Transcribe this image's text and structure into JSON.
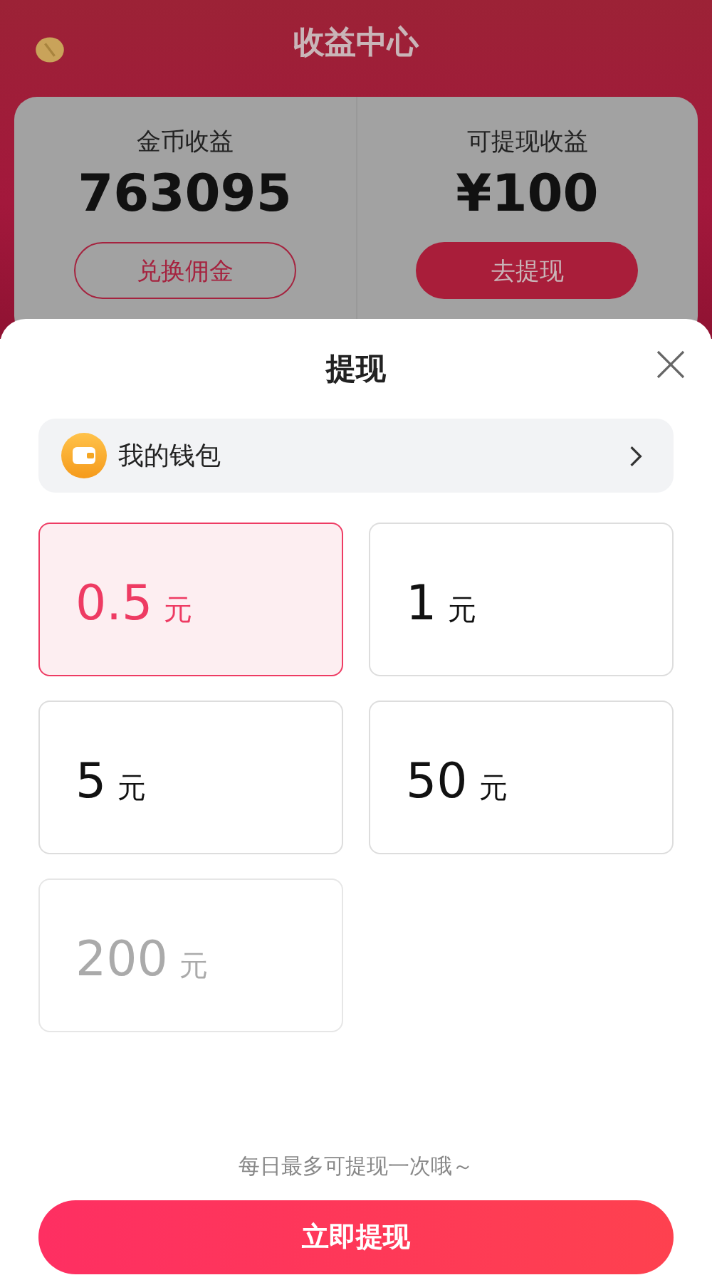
{
  "page_title": "收益中心",
  "stats": [
    {
      "label": "金币收益",
      "value": "763095",
      "button": "兑换佣金",
      "kind": "outline"
    },
    {
      "label": "可提现收益",
      "value": "¥100",
      "button": "去提现",
      "kind": "filled"
    }
  ],
  "sheet": {
    "title": "提现",
    "wallet": "我的钱包",
    "options": [
      {
        "amount": "0.5",
        "unit": "元",
        "selected": true,
        "disabled": false
      },
      {
        "amount": "1",
        "unit": "元",
        "selected": false,
        "disabled": false
      },
      {
        "amount": "5",
        "unit": "元",
        "selected": false,
        "disabled": false
      },
      {
        "amount": "50",
        "unit": "元",
        "selected": false,
        "disabled": false
      },
      {
        "amount": "200",
        "unit": "元",
        "selected": false,
        "disabled": true
      }
    ],
    "note": "每日最多可提现一次哦～",
    "submit": "立即提现"
  }
}
